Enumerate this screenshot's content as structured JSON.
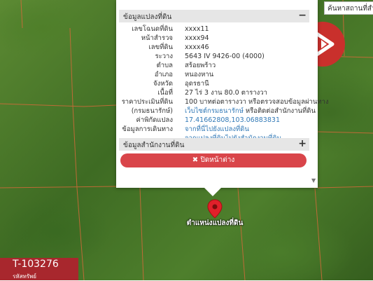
{
  "search": {
    "placeholder": "ค้นหาสถานที่สำคัญ"
  },
  "land_info": {
    "header": "ข้อมูลแปลงที่ดิน",
    "toggle": "−",
    "rows": [
      {
        "label": "เลขโฉนดที่ดิน",
        "value": "xxxx11"
      },
      {
        "label": "หน้าสำรวจ",
        "value": "xxxx94"
      },
      {
        "label": "เลขที่ดิน",
        "value": "xxxx46"
      },
      {
        "label": "ระวาง",
        "value": "5643 IV 9426-00 (4000)"
      },
      {
        "label": "ตำบล",
        "value": "สร้อยพร้าว"
      },
      {
        "label": "อำเภอ",
        "value": "หนองหาน"
      },
      {
        "label": "จังหวัด",
        "value": "อุดรธานี"
      },
      {
        "label": "เนื้อที่",
        "value": "27 ไร่ 3 งาน 80.0 ตารางวา"
      },
      {
        "label": "ราคาประเมินที่ดิน",
        "value": "100 บาทต่อตารางวา หรือตรวจสอบข้อมูลผ่านทาง"
      },
      {
        "label": "(กรมธนารักษ์)",
        "value": "เว็บไซต์กรมธนารักษ์",
        "value_suffix": " หรือติดต่อสำนักงานที่ดิน"
      },
      {
        "label": "ค่าพิกัดแปลง",
        "value": "17.41662808,103.06883831"
      },
      {
        "label": "ข้อมูลการเดินทาง",
        "value": "จากที่นี่ไปยังแปลงที่ดิน"
      },
      {
        "label": "",
        "value": "จากแปลงที่ดินไปยังสำนักงานที่ดิน"
      }
    ]
  },
  "office_info": {
    "header": "ข้อมูลสำนักงานที่ดิน",
    "toggle": "+"
  },
  "close_button": {
    "icon": "✖",
    "label": "ปิดหน้าต่าง"
  },
  "scroll_arrow": "▼",
  "map": {
    "pin_label": "ตำแหน่งแปลงที่ดิน"
  },
  "property": {
    "code": "T-103276",
    "sub": "รหัสทรัพย์"
  },
  "colors": {
    "accent": "#d9454a",
    "badge": "#a8272d",
    "link": "#337ab7",
    "parcel_line": "#d46a3a"
  }
}
